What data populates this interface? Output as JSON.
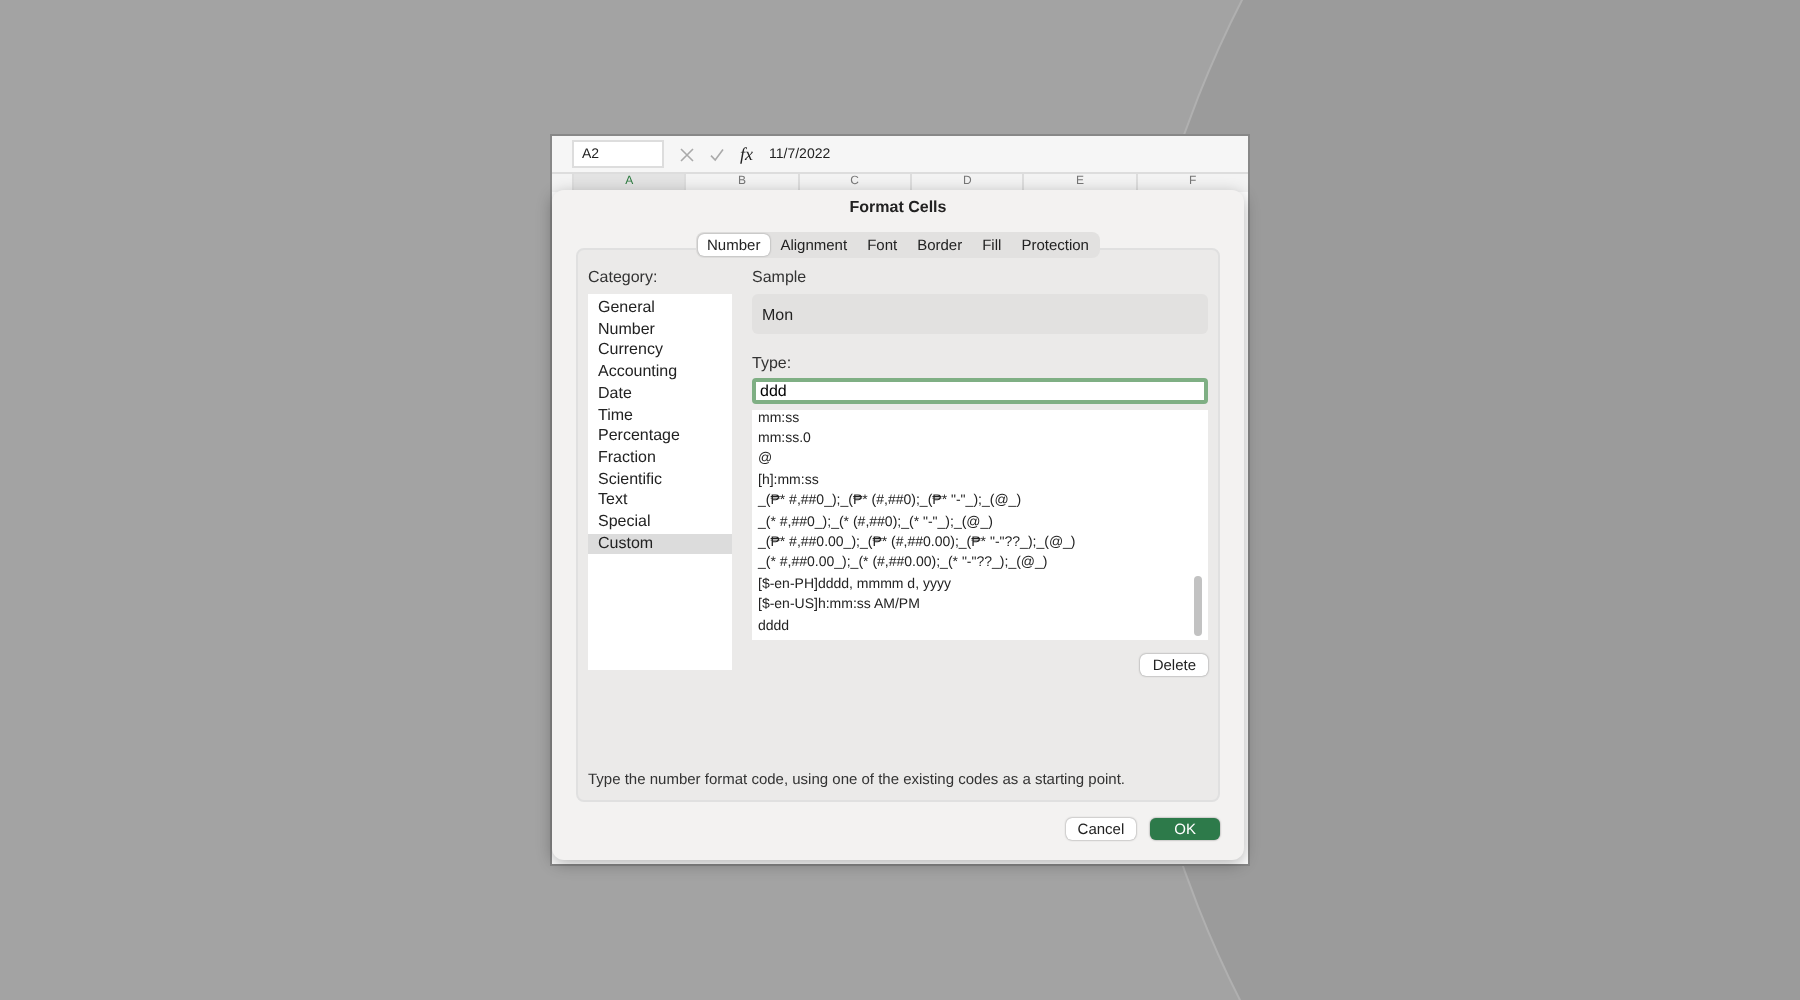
{
  "formula_bar": {
    "name_box": "A2",
    "fx": "fx",
    "value": "11/7/2022"
  },
  "columns": [
    {
      "label": "A",
      "selected": true
    },
    {
      "label": "B",
      "selected": false
    },
    {
      "label": "C",
      "selected": false
    },
    {
      "label": "D",
      "selected": false
    },
    {
      "label": "E",
      "selected": false
    },
    {
      "label": "F",
      "selected": false
    }
  ],
  "dialog": {
    "title": "Format Cells",
    "tabs": [
      {
        "label": "Number",
        "selected": true
      },
      {
        "label": "Alignment",
        "selected": false
      },
      {
        "label": "Font",
        "selected": false
      },
      {
        "label": "Border",
        "selected": false
      },
      {
        "label": "Fill",
        "selected": false
      },
      {
        "label": "Protection",
        "selected": false
      }
    ],
    "category_label": "Category:",
    "categories": [
      {
        "label": "General",
        "selected": false
      },
      {
        "label": "Number",
        "selected": false
      },
      {
        "label": "Currency",
        "selected": false
      },
      {
        "label": "Accounting",
        "selected": false
      },
      {
        "label": "Date",
        "selected": false
      },
      {
        "label": "Time",
        "selected": false
      },
      {
        "label": "Percentage",
        "selected": false
      },
      {
        "label": "Fraction",
        "selected": false
      },
      {
        "label": "Scientific",
        "selected": false
      },
      {
        "label": "Text",
        "selected": false
      },
      {
        "label": "Special",
        "selected": false
      },
      {
        "label": "Custom",
        "selected": true
      }
    ],
    "sample_label": "Sample",
    "sample": "Mon",
    "type_label": "Type:",
    "type_value": "ddd",
    "type_list": [
      "mm:ss",
      "mm:ss.0",
      "@",
      "[h]:mm:ss",
      "_(₱* #,##0_);_(₱* (#,##0);_(₱* \"-\"_);_(@_)",
      "_(* #,##0_);_(* (#,##0);_(* \"-\"_);_(@_)",
      "_(₱* #,##0.00_);_(₱* (#,##0.00);_(₱* \"-\"??_);_(@_)",
      "_(* #,##0.00_);_(* (#,##0.00);_(* \"-\"??_);_(@_)",
      "[$-en-PH]dddd, mmmm d, yyyy",
      "[$-en-US]h:mm:ss AM/PM",
      "dddd"
    ],
    "delete_button": "Delete",
    "hint": "Type the number format code, using one of the existing codes as a starting point.",
    "buttons": [
      {
        "label": "Cancel",
        "kind": "secondary"
      },
      {
        "label": "OK",
        "kind": "primary"
      }
    ]
  }
}
